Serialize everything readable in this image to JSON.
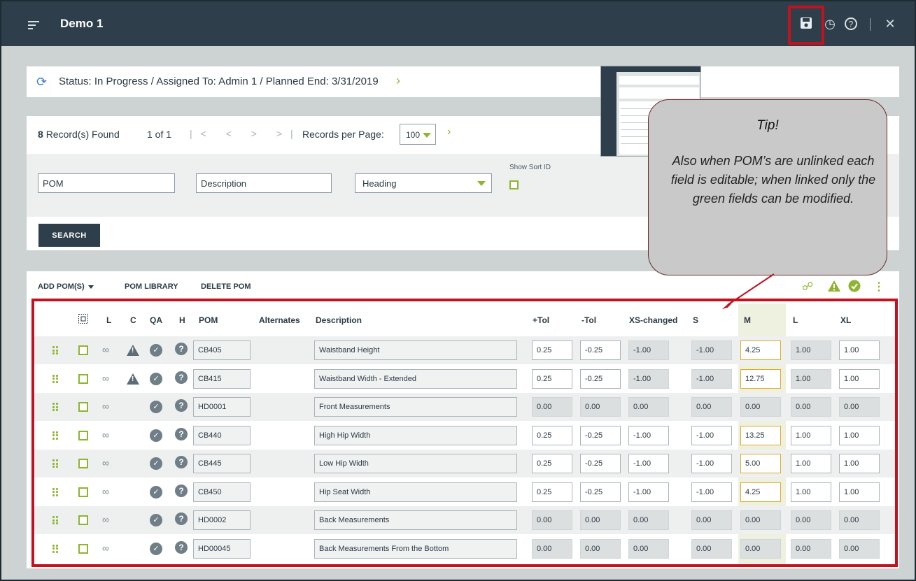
{
  "header": {
    "title": "Demo 1"
  },
  "status": {
    "text": "Status: In Progress / Assigned To: Admin 1 / Planned End: 3/31/2019"
  },
  "search": {
    "records_count": "8",
    "records_label": "Record(s) Found",
    "page_info": "1 of 1",
    "pager_symbols": "|< < > >|",
    "records_per_page_label": "Records per Page:",
    "records_per_page_value": "100",
    "pom_placeholder": "POM",
    "description_placeholder": "Description",
    "heading_value": "Heading",
    "show_sort_id_label": "Show Sort ID",
    "search_button": "SEARCH"
  },
  "toolbar": {
    "add_poms": "ADD POM(S)",
    "pom_library": "POM LIBRARY",
    "delete_pom": "DELETE POM"
  },
  "table": {
    "headers": {
      "l": "L",
      "c": "C",
      "qa": "QA",
      "h": "H",
      "pom": "POM",
      "alternates": "Alternates",
      "description": "Description",
      "plus_tol": "+Tol",
      "minus_tol": "-Tol",
      "xs": "XS-changed",
      "s": "S",
      "m": "M",
      "l_size": "L",
      "xl": "XL"
    },
    "rows": [
      {
        "pom": "CB405",
        "description": "Waistband Height",
        "plus_tol": "0.25",
        "minus_tol": "-0.25",
        "xs": "-1.00",
        "s": "-1.00",
        "m": "4.25",
        "l": "1.00",
        "xl": "1.00",
        "warn": true,
        "heading": false
      },
      {
        "pom": "CB415",
        "description": "Waistband Width - Extended",
        "plus_tol": "0.25",
        "minus_tol": "-0.25",
        "xs": "-1.00",
        "s": "-1.00",
        "m": "12.75",
        "l": "1.00",
        "xl": "1.00",
        "warn": true,
        "heading": false
      },
      {
        "pom": "HD0001",
        "description": "Front Measurements",
        "plus_tol": "0.00",
        "minus_tol": "0.00",
        "xs": "0.00",
        "s": "0.00",
        "m": "0.00",
        "l": "0.00",
        "xl": "0.00",
        "warn": false,
        "heading": true
      },
      {
        "pom": "CB440",
        "description": "High Hip Width",
        "plus_tol": "0.25",
        "minus_tol": "-0.25",
        "xs": "-1.00",
        "s": "-1.00",
        "m": "13.25",
        "l": "1.00",
        "xl": "1.00",
        "warn": false,
        "heading": false
      },
      {
        "pom": "CB445",
        "description": "Low Hip Width",
        "plus_tol": "0.25",
        "minus_tol": "-0.25",
        "xs": "-1.00",
        "s": "-1.00",
        "m": "5.00",
        "l": "1.00",
        "xl": "1.00",
        "warn": false,
        "heading": false
      },
      {
        "pom": "CB450",
        "description": "Hip Seat Width",
        "plus_tol": "0.25",
        "minus_tol": "-0.25",
        "xs": "-1.00",
        "s": "-1.00",
        "m": "4.25",
        "l": "1.00",
        "xl": "1.00",
        "warn": false,
        "heading": false
      },
      {
        "pom": "HD0002",
        "description": "Back Measurements",
        "plus_tol": "0.00",
        "minus_tol": "0.00",
        "xs": "0.00",
        "s": "0.00",
        "m": "0.00",
        "l": "0.00",
        "xl": "0.00",
        "warn": false,
        "heading": true
      },
      {
        "pom": "HD00045",
        "description": "Back Measurements From the Bottom",
        "plus_tol": "0.00",
        "minus_tol": "0.00",
        "xs": "0.00",
        "s": "0.00",
        "m": "0.00",
        "l": "0.00",
        "xl": "0.00",
        "warn": false,
        "heading": true
      }
    ]
  },
  "tip": {
    "title": "Tip!",
    "body": "Also when POM’s are unlinked each field is editable; when linked only the green fields can be modified."
  },
  "colors": {
    "accent_green": "#8fb530",
    "header_bg": "#2e3f4b",
    "highlight_red": "#c1121f",
    "m_cell_border": "#e3a92a"
  },
  "icons": [
    "menu-icon",
    "save-icon",
    "history-icon",
    "help-icon",
    "close-icon",
    "sync-icon",
    "link-icon",
    "warning-icon",
    "check-icon",
    "more-icon",
    "drag-handle-icon"
  ]
}
